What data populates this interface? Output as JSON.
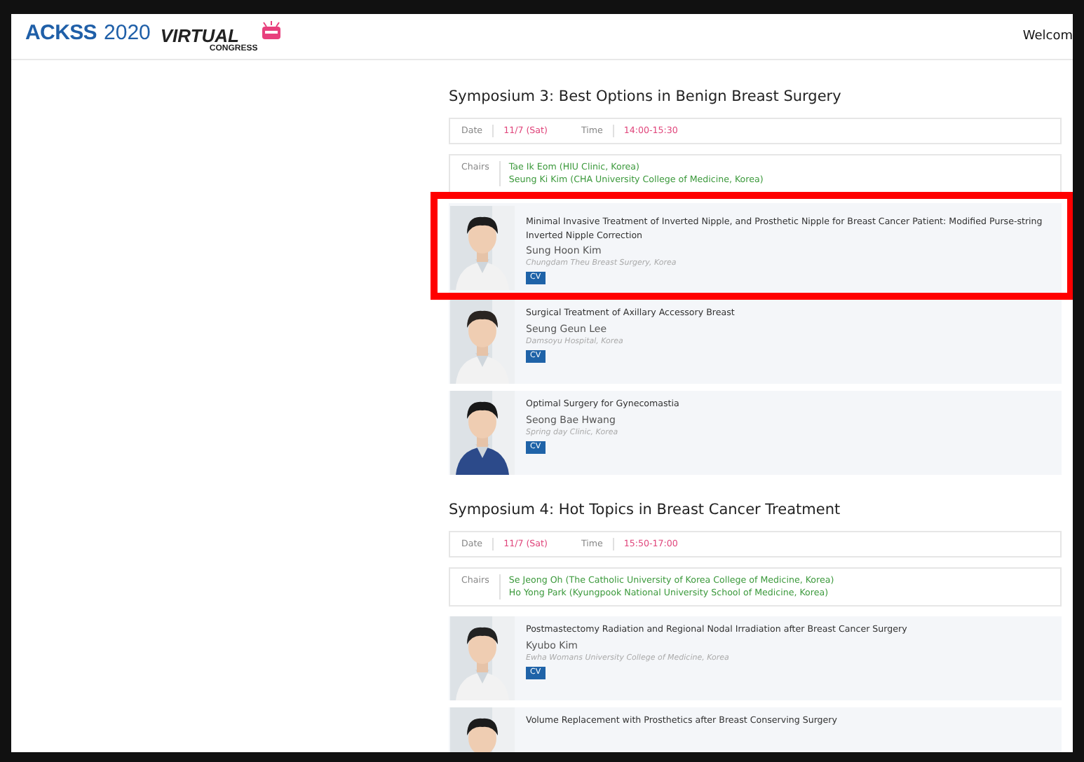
{
  "header": {
    "logo": {
      "acronym": "ACKSS",
      "year": "2020",
      "virtual": "VIRTUAL",
      "congress": "CONGRESS"
    },
    "welcome": "Welcom"
  },
  "symposia": [
    {
      "title": "Symposium 3: Best Options in Benign Breast Surgery",
      "date_label": "Date",
      "date": "11/7 (Sat)",
      "time_label": "Time",
      "time": "14:00-15:30",
      "chairs_label": "Chairs",
      "chairs": [
        "Tae Ik Eom (HIU Clinic, Korea)",
        "Seung Ki Kim (CHA University College of Medicine, Korea)"
      ],
      "talks": [
        {
          "title": "Minimal Invasive Treatment of Inverted Nipple, and Prosthetic Nipple for Breast Cancer Patient: Modified Purse-string Inverted Nipple Correction",
          "speaker": "Sung Hoon Kim",
          "affiliation": "Chungdam Theu Breast Surgery, Korea",
          "button": "CV",
          "highlighted": true
        },
        {
          "title": "Surgical Treatment of Axillary Accessory Breast",
          "speaker": "Seung Geun Lee",
          "affiliation": "Damsoyu Hospital, Korea",
          "button": "CV",
          "highlighted": false
        },
        {
          "title": "Optimal Surgery for Gynecomastia",
          "speaker": "Seong Bae Hwang",
          "affiliation": "Spring day Clinic, Korea",
          "button": "CV",
          "highlighted": false
        }
      ]
    },
    {
      "title": "Symposium 4: Hot Topics in Breast Cancer Treatment",
      "date_label": "Date",
      "date": "11/7 (Sat)",
      "time_label": "Time",
      "time": "15:50-17:00",
      "chairs_label": "Chairs",
      "chairs": [
        "Se Jeong Oh (The Catholic University of Korea College of Medicine, Korea)",
        "Ho Yong Park (Kyungpook National University School of Medicine, Korea)"
      ],
      "talks": [
        {
          "title": "Postmastectomy Radiation and Regional Nodal Irradiation after Breast Cancer Surgery",
          "speaker": "Kyubo Kim",
          "affiliation": "Ewha Womans University College of Medicine, Korea",
          "button": "CV",
          "highlighted": false
        },
        {
          "title": "Volume Replacement with Prosthetics after Breast Conserving Surgery",
          "highlighted": false
        }
      ]
    }
  ]
}
